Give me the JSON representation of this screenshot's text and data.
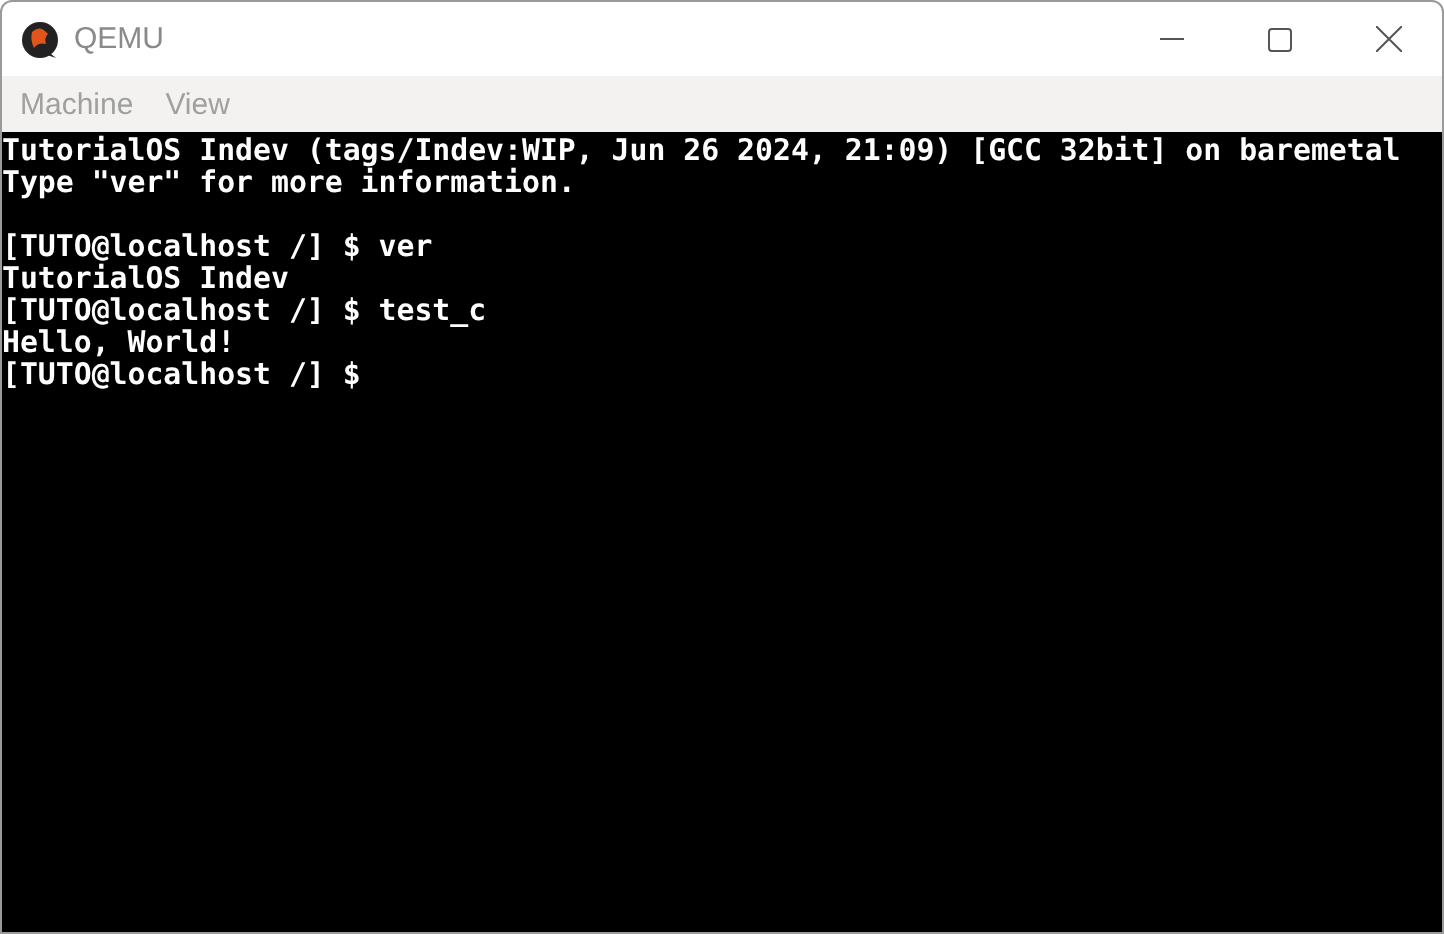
{
  "window": {
    "title": "QEMU"
  },
  "menu": [
    "Machine",
    "View"
  ],
  "console": {
    "blocks": [
      [
        "TutorialOS Indev (tags/Indev:WIP, Jun 26 2024, 21:09) [GCC 32bit] on baremetal",
        "Type \"ver\" for more information."
      ],
      [
        "[TUTO@localhost /] $ ver",
        "TutorialOS Indev",
        "[TUTO@localhost /] $ test_c",
        "Hello, World!",
        "[TUTO@localhost /] $"
      ]
    ]
  }
}
